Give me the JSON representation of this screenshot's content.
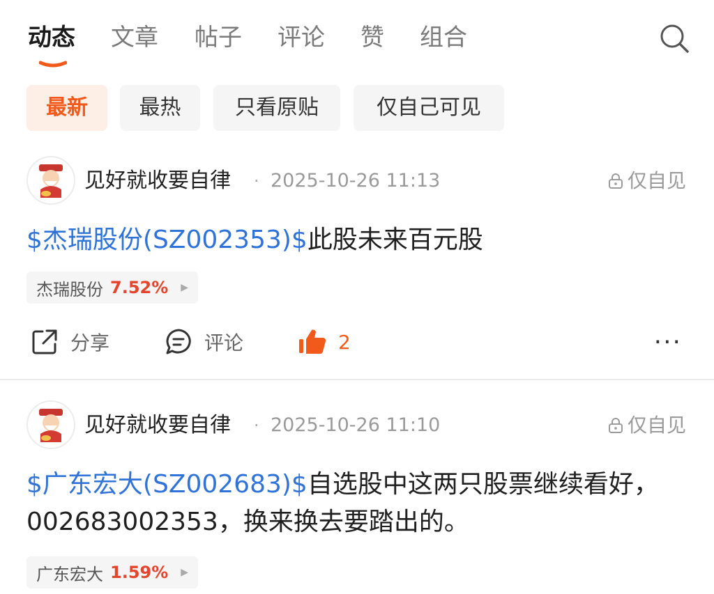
{
  "tabs": [
    {
      "label": "动态",
      "active": true
    },
    {
      "label": "文章",
      "active": false
    },
    {
      "label": "帖子",
      "active": false
    },
    {
      "label": "评论",
      "active": false
    },
    {
      "label": "赞",
      "active": false
    },
    {
      "label": "组合",
      "active": false
    }
  ],
  "filters": [
    {
      "label": "最新",
      "active": true
    },
    {
      "label": "最热",
      "active": false
    },
    {
      "label": "只看原贴",
      "active": false
    },
    {
      "label": "仅自己可见",
      "active": false
    }
  ],
  "colors": {
    "accent": "#f25a1c",
    "link": "#2f73d8",
    "rise": "#e4452c"
  },
  "icons": [
    "search-icon",
    "lock-icon",
    "share-icon",
    "comment-icon",
    "thumbs-up-icon",
    "more-icon",
    "caret-right-icon"
  ],
  "posts": [
    {
      "author": "见好就收要自律",
      "separator": "·",
      "time": "2025-10-26 11:13",
      "privacy": "仅自见",
      "stock_link": "$杰瑞股份(SZ002353)$",
      "text": "此股未来百元股",
      "stock_name": "杰瑞股份",
      "stock_change": "7.52%",
      "share_label": "分享",
      "comment_label": "评论",
      "like_count": "2",
      "more": "···"
    },
    {
      "author": "见好就收要自律",
      "separator": "·",
      "time": "2025-10-26 11:10",
      "privacy": "仅自见",
      "stock_link": "$广东宏大(SZ002683)$",
      "text": "自选股中这两只股票继续看好，002683002353，换来换去要踏出的。",
      "stock_name": "广东宏大",
      "stock_change": "1.59%"
    }
  ]
}
